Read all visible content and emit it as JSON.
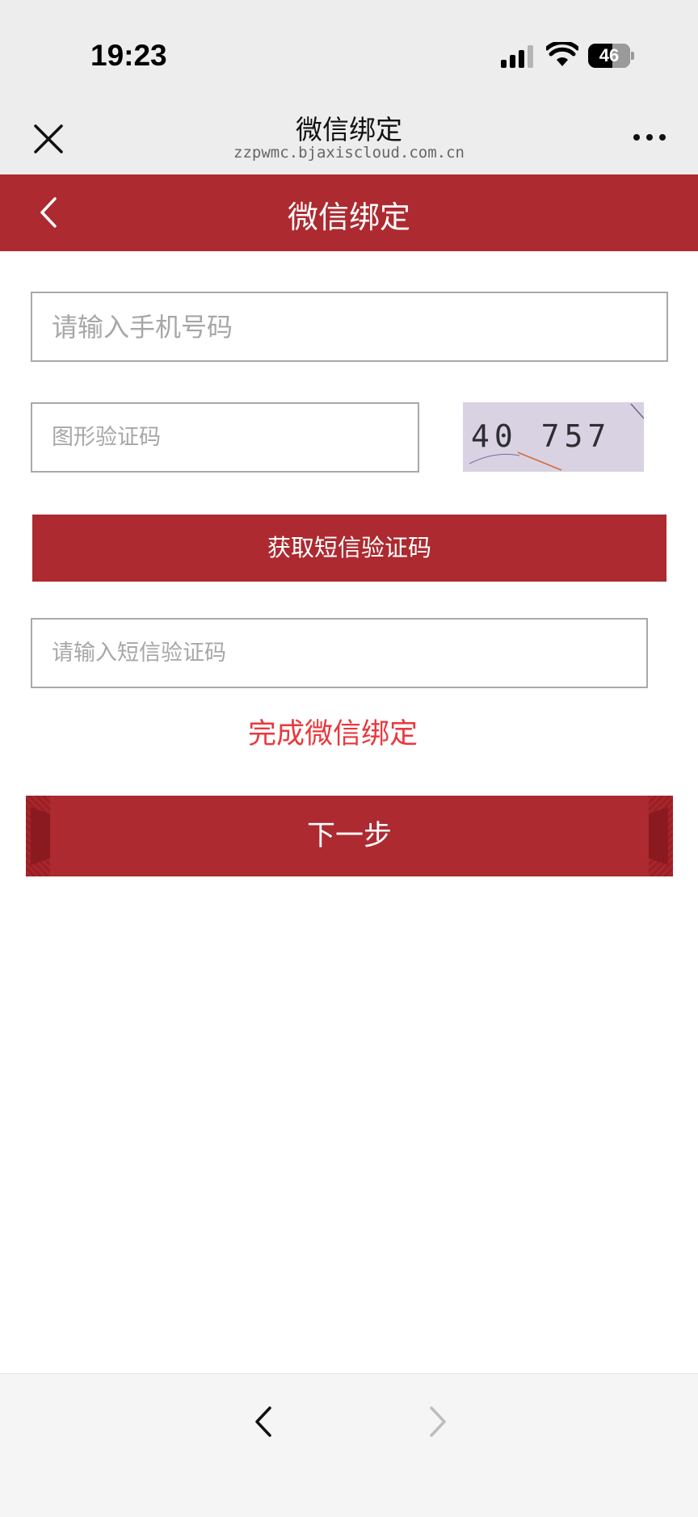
{
  "status_bar": {
    "time": "19:23",
    "battery": "46",
    "icons": [
      "signal-icon",
      "wifi-icon",
      "battery-icon"
    ]
  },
  "browser": {
    "title": "微信绑定",
    "url": "zzpwmc.bjaxiscloud.com.cn",
    "close_icon": "close-icon",
    "more_icon": "more-icon"
  },
  "header": {
    "title": "微信绑定",
    "back_icon": "chevron-left-icon"
  },
  "form": {
    "phone_placeholder": "请输入手机号码",
    "phone_value": "",
    "captcha_placeholder": "图形验证码",
    "captcha_value": "",
    "captcha_image_text": "40 757",
    "sms_button_label": "获取短信验证码",
    "sms_placeholder": "请输入短信验证码",
    "sms_value": "",
    "done_text": "完成微信绑定",
    "next_label": "下一步"
  },
  "bottom_nav": {
    "back_icon": "chevron-left-icon",
    "forward_icon": "chevron-right-icon"
  },
  "colors": {
    "primary": "#ac2a30",
    "accent_text": "#e8393d",
    "chrome_bg": "#ededed"
  }
}
